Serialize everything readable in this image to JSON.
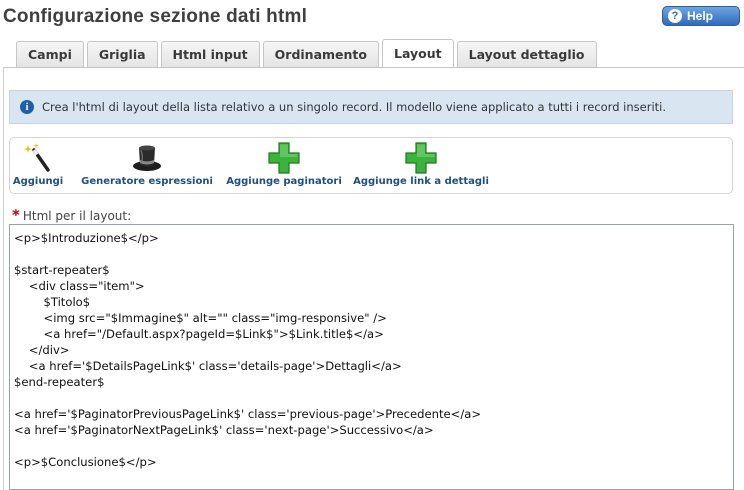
{
  "header": {
    "title": "Configurazione sezione dati html",
    "help_label": "Help",
    "help_icon": "question-icon"
  },
  "tabs": [
    {
      "label": "Campi",
      "active": false
    },
    {
      "label": "Griglia",
      "active": false
    },
    {
      "label": "Html input",
      "active": false
    },
    {
      "label": "Ordinamento",
      "active": false
    },
    {
      "label": "Layout",
      "active": true
    },
    {
      "label": "Layout dettaglio",
      "active": false
    }
  ],
  "info": {
    "text": "Crea l'html di layout della lista relativo a un singolo record. Il modello viene applicato a tutti i record inseriti.",
    "icon": "info-icon"
  },
  "toolbar": {
    "items": [
      {
        "label": "Aggiungi",
        "icon": "magic-wand-icon"
      },
      {
        "label": "Generatore espressioni",
        "icon": "magic-hat-icon"
      },
      {
        "label": "Aggiunge paginatori",
        "icon": "green-plus-icon"
      },
      {
        "label": "Aggiunge link a dettagli",
        "icon": "green-plus-icon"
      }
    ]
  },
  "field": {
    "label": "Html per il layout:",
    "required_mark": "*"
  },
  "editor": {
    "content": "<p>$Introduzione$</p>\n\n$start-repeater$\n    <div class=\"item\">\n        $Titolo$\n        <img src=\"$Immagine$\" alt=\"\" class=\"img-responsive\" />\n        <a href=\"/Default.aspx?pageId=$Link$\">$Link.title$</a>\n    </div>\n    <a href='$DetailsPageLink$' class='details-page'>Dettagli</a>\n$end-repeater$\n\n<a href='$PaginatorPreviousPageLink$' class='previous-page'>Precedente</a>\n<a href='$PaginatorNextPageLink$' class='next-page'>Successivo</a>\n\n<p>$Conclusione$</p>"
  },
  "colors": {
    "accent": "#2f6bbd",
    "info_bg": "#d9e6f2",
    "link": "#1f4f82",
    "plus": "#3db33d"
  }
}
